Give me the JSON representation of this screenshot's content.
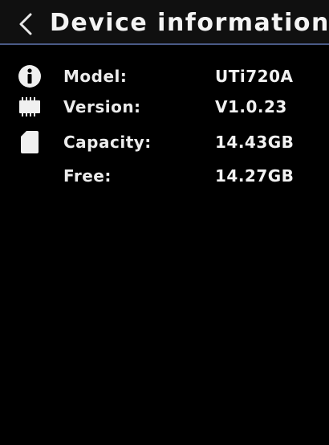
{
  "header": {
    "title": "Device information",
    "back_icon": "chevron-left-icon"
  },
  "rows": [
    {
      "label": "Model:",
      "value": "UTi720A",
      "icon": "info-icon"
    },
    {
      "label": "Version:",
      "value": "V1.0.23",
      "icon": "chip-icon"
    },
    {
      "label": "Capacity:",
      "value": "14.43GB",
      "icon": "sd-card-icon"
    },
    {
      "label": "Free:",
      "value": "14.27GB",
      "icon": ""
    }
  ],
  "colors": {
    "background": "#000000",
    "divider": "#4a5a86",
    "text": "#f2f2f2"
  }
}
